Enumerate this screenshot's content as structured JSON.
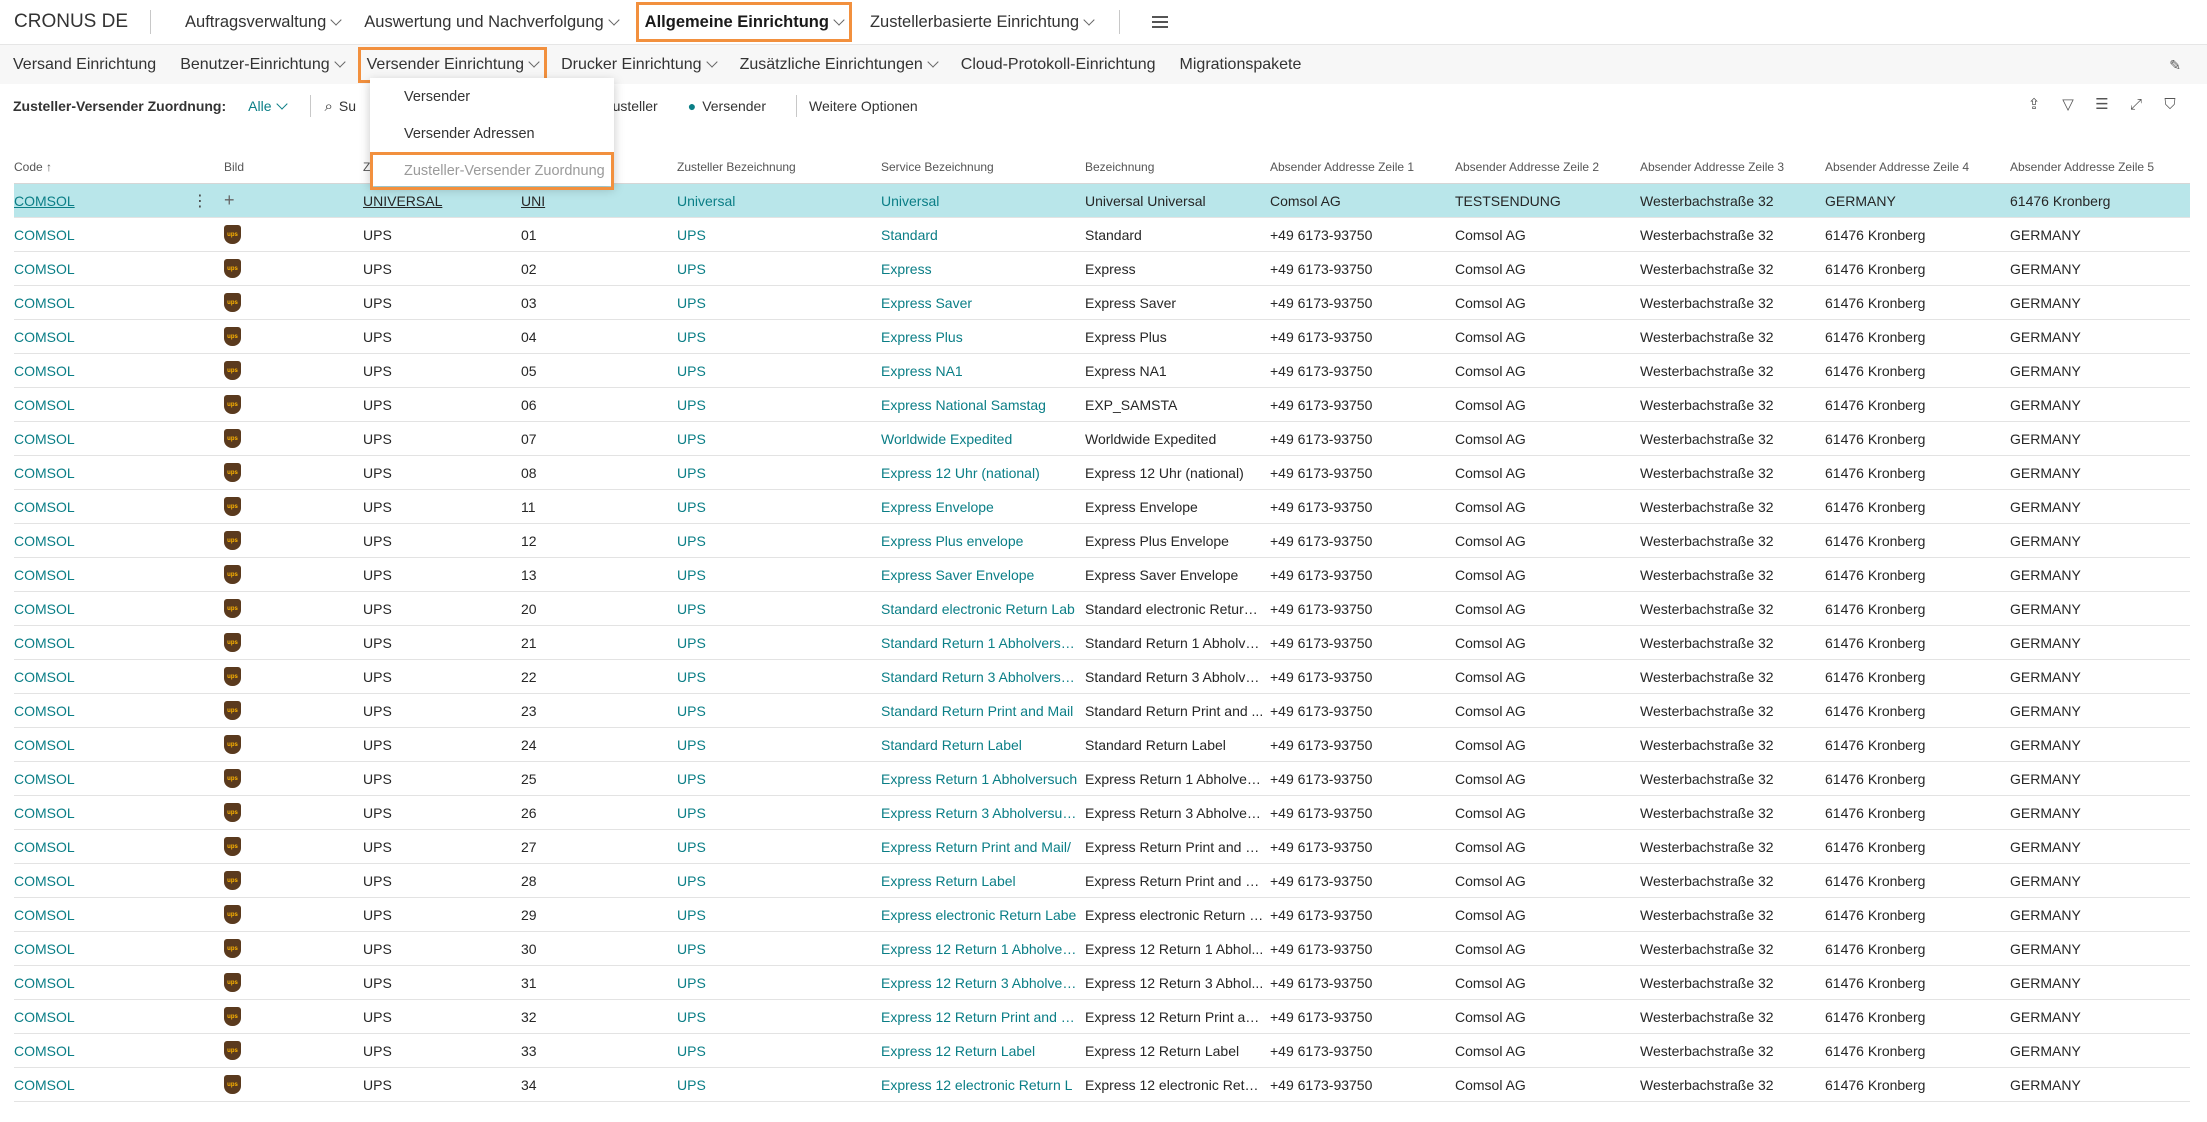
{
  "app": {
    "company": "CRONUS DE"
  },
  "nav": {
    "items": [
      {
        "label": "Auftragsverwaltung"
      },
      {
        "label": "Auswertung und Nachverfolgung"
      },
      {
        "label": "Allgemeine Einrichtung",
        "active": true
      },
      {
        "label": "Zustellerbasierte Einrichtung"
      }
    ]
  },
  "subnav": {
    "items": [
      {
        "label": "Versand Einrichtung"
      },
      {
        "label": "Benutzer-Einrichtung"
      },
      {
        "label": "Versender Einrichtung",
        "active": true
      },
      {
        "label": "Drucker Einrichtung"
      },
      {
        "label": "Zusätzliche Einrichtungen"
      },
      {
        "label": "Cloud-Protokoll-Einrichtung"
      },
      {
        "label": "Migrationspakete"
      }
    ]
  },
  "dropdown": {
    "items": [
      "Versender",
      "Versender Adressen",
      "Zusteller-Versender Zuordnung"
    ]
  },
  "filter": {
    "label": "Zusteller-Versender Zuordnung:",
    "value": "Alle",
    "search_label": "Su",
    "zusteller": "Zusteller",
    "versender": "Versender",
    "more": "Weitere Optionen"
  },
  "table": {
    "headers": [
      "Code",
      "Bild",
      "Z",
      "",
      "Zusteller Bezeichnung",
      "Service Bezeichnung",
      "Bezeichnung",
      "Absender Addresse Zeile 1",
      "Absender Addresse Zeile 2",
      "Absender Addresse Zeile 3",
      "Absender Addresse Zeile 4",
      "Absender Addresse Zeile 5"
    ],
    "first_row": [
      "COMSOL",
      "",
      "UNIVERSAL",
      "UNI",
      "Universal",
      "Universal",
      "Universal Universal",
      "Comsol AG",
      "TESTSENDUNG",
      "Westerbachstraße 32",
      "GERMANY",
      "61476 Kronberg"
    ],
    "rows": [
      [
        "COMSOL",
        "UPS",
        "01",
        "UPS",
        "Standard",
        "Standard"
      ],
      [
        "COMSOL",
        "UPS",
        "02",
        "UPS",
        "Express",
        "Express"
      ],
      [
        "COMSOL",
        "UPS",
        "03",
        "UPS",
        "Express Saver",
        "Express Saver"
      ],
      [
        "COMSOL",
        "UPS",
        "04",
        "UPS",
        "Express Plus",
        "Express Plus"
      ],
      [
        "COMSOL",
        "UPS",
        "05",
        "UPS",
        "Express NA1",
        "Express NA1"
      ],
      [
        "COMSOL",
        "UPS",
        "06",
        "UPS",
        "Express National Samstag",
        "EXP_SAMSTA"
      ],
      [
        "COMSOL",
        "UPS",
        "07",
        "UPS",
        "Worldwide Expedited",
        "Worldwide Expedited"
      ],
      [
        "COMSOL",
        "UPS",
        "08",
        "UPS",
        "Express 12 Uhr (national)",
        "Express 12 Uhr (national)"
      ],
      [
        "COMSOL",
        "UPS",
        "11",
        "UPS",
        "Express Envelope",
        "Express Envelope"
      ],
      [
        "COMSOL",
        "UPS",
        "12",
        "UPS",
        "Express Plus envelope",
        "Express Plus Envelope"
      ],
      [
        "COMSOL",
        "UPS",
        "13",
        "UPS",
        "Express Saver Envelope",
        "Express Saver Envelope"
      ],
      [
        "COMSOL",
        "UPS",
        "20",
        "UPS",
        "Standard electronic Return Lab",
        "Standard electronic Return ..."
      ],
      [
        "COMSOL",
        "UPS",
        "21",
        "UPS",
        "Standard Return 1 Abholversu...",
        "Standard Return 1 Abholve..."
      ],
      [
        "COMSOL",
        "UPS",
        "22",
        "UPS",
        "Standard Return 3 Abholversu...",
        "Standard Return 3 Abholve..."
      ],
      [
        "COMSOL",
        "UPS",
        "23",
        "UPS",
        "Standard Return Print and Mail",
        "Standard Return Print and ..."
      ],
      [
        "COMSOL",
        "UPS",
        "24",
        "UPS",
        "Standard Return Label",
        "Standard Return Label"
      ],
      [
        "COMSOL",
        "UPS",
        "25",
        "UPS",
        "Express Return 1 Abholversuch",
        "Express Return 1 Abholvers..."
      ],
      [
        "COMSOL",
        "UPS",
        "26",
        "UPS",
        "Express Return 3 Abholversuc...",
        "Express Return 3 Abholvers..."
      ],
      [
        "COMSOL",
        "UPS",
        "27",
        "UPS",
        "Express Return Print and Mail/",
        "Express Return Print and M..."
      ],
      [
        "COMSOL",
        "UPS",
        "28",
        "UPS",
        "Express Return Label",
        "Express Return Print and M..."
      ],
      [
        "COMSOL",
        "UPS",
        "29",
        "UPS",
        "Express electronic Return Labe",
        "Express electronic Return L..."
      ],
      [
        "COMSOL",
        "UPS",
        "30",
        "UPS",
        "Express 12 Return 1 Abholversu",
        "Express 12 Return 1 Abhol..."
      ],
      [
        "COMSOL",
        "UPS",
        "31",
        "UPS",
        "Express 12 Return 3 Abholversu",
        "Express 12 Return 3 Abhol..."
      ],
      [
        "COMSOL",
        "UPS",
        "32",
        "UPS",
        "Express 12 Return Print and Ma",
        "Express 12 Return Print an..."
      ],
      [
        "COMSOL",
        "UPS",
        "33",
        "UPS",
        "Express 12 Return Label",
        "Express 12 Return Label"
      ],
      [
        "COMSOL",
        "UPS",
        "34",
        "UPS",
        "Express 12 electronic Return L",
        "Express 12 electronic Retur..."
      ]
    ],
    "common": {
      "addr1": "+49 6173-93750",
      "addr2": "Comsol AG",
      "addr3": "Westerbachstraße 32",
      "addr4": "61476 Kronberg",
      "addr5": "GERMANY"
    },
    "ups_logo_text": "ups"
  },
  "colors": {
    "accent_highlight": "#f2903e",
    "link": "#0a7e86",
    "selected_row": "#b9e6ea"
  }
}
